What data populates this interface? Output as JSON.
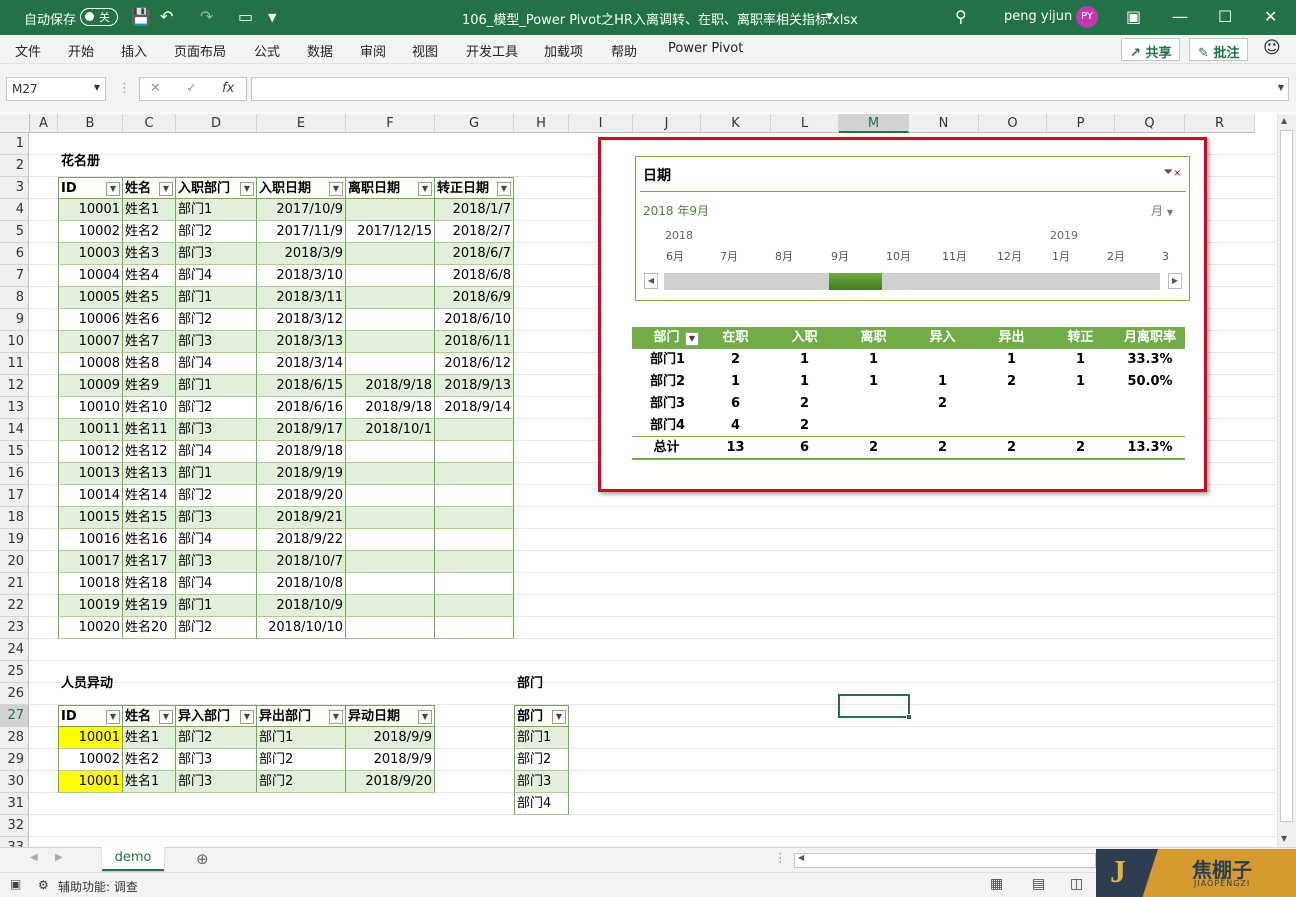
{
  "window": {
    "autosave_label": "自动保存",
    "autosave_state": "关",
    "filename": "106_模型_Power Pivot之HR入离调转、在职、离职率相关指标.xlsx",
    "user": "peng yijun",
    "avatar": "PY"
  },
  "menu": [
    "文件",
    "开始",
    "插入",
    "页面布局",
    "公式",
    "数据",
    "审阅",
    "视图",
    "开发工具",
    "加载项",
    "帮助",
    "Power Pivot"
  ],
  "share_label": "共享",
  "comment_label": "批注",
  "namebox": "M27",
  "fx": "fx",
  "columns": [
    "A",
    "B",
    "C",
    "D",
    "E",
    "F",
    "G",
    "H",
    "I",
    "J",
    "K",
    "L",
    "M",
    "N",
    "O",
    "P",
    "Q",
    "R"
  ],
  "rows": [
    "1",
    "2",
    "3",
    "4",
    "5",
    "6",
    "7",
    "8",
    "9",
    "10",
    "11",
    "12",
    "13",
    "14",
    "15",
    "16",
    "17",
    "18",
    "19",
    "20",
    "21",
    "22",
    "23",
    "24",
    "25",
    "26",
    "27",
    "28",
    "29",
    "30",
    "31",
    "32",
    "33"
  ],
  "roster": {
    "title": "花名册",
    "headers": [
      "ID",
      "姓名",
      "入职部门",
      "入职日期",
      "离职日期",
      "转正日期"
    ],
    "rows": [
      [
        "10001",
        "姓名1",
        "部门1",
        "2017/10/9",
        "",
        "2018/1/7"
      ],
      [
        "10002",
        "姓名2",
        "部门2",
        "2017/11/9",
        "2017/12/15",
        "2018/2/7"
      ],
      [
        "10003",
        "姓名3",
        "部门3",
        "2018/3/9",
        "",
        "2018/6/7"
      ],
      [
        "10004",
        "姓名4",
        "部门4",
        "2018/3/10",
        "",
        "2018/6/8"
      ],
      [
        "10005",
        "姓名5",
        "部门1",
        "2018/3/11",
        "",
        "2018/6/9"
      ],
      [
        "10006",
        "姓名6",
        "部门2",
        "2018/3/12",
        "",
        "2018/6/10"
      ],
      [
        "10007",
        "姓名7",
        "部门3",
        "2018/3/13",
        "",
        "2018/6/11"
      ],
      [
        "10008",
        "姓名8",
        "部门4",
        "2018/3/14",
        "",
        "2018/6/12"
      ],
      [
        "10009",
        "姓名9",
        "部门1",
        "2018/6/15",
        "2018/9/18",
        "2018/9/13"
      ],
      [
        "10010",
        "姓名10",
        "部门2",
        "2018/6/16",
        "2018/9/18",
        "2018/9/14"
      ],
      [
        "10011",
        "姓名11",
        "部门3",
        "2018/9/17",
        "2018/10/1",
        ""
      ],
      [
        "10012",
        "姓名12",
        "部门4",
        "2018/9/18",
        "",
        ""
      ],
      [
        "10013",
        "姓名13",
        "部门1",
        "2018/9/19",
        "",
        ""
      ],
      [
        "10014",
        "姓名14",
        "部门2",
        "2018/9/20",
        "",
        ""
      ],
      [
        "10015",
        "姓名15",
        "部门3",
        "2018/9/21",
        "",
        ""
      ],
      [
        "10016",
        "姓名16",
        "部门4",
        "2018/9/22",
        "",
        ""
      ],
      [
        "10017",
        "姓名17",
        "部门3",
        "2018/10/7",
        "",
        ""
      ],
      [
        "10018",
        "姓名18",
        "部门4",
        "2018/10/8",
        "",
        ""
      ],
      [
        "10019",
        "姓名19",
        "部门1",
        "2018/10/9",
        "",
        ""
      ],
      [
        "10020",
        "姓名20",
        "部门2",
        "2018/10/10",
        "",
        ""
      ]
    ]
  },
  "transfer": {
    "title": "人员异动",
    "headers": [
      "ID",
      "姓名",
      "异入部门",
      "异出部门",
      "异动日期"
    ],
    "rows": [
      [
        "10001",
        "姓名1",
        "部门2",
        "部门1",
        "2018/9/9"
      ],
      [
        "10002",
        "姓名2",
        "部门3",
        "部门2",
        "2018/9/9"
      ],
      [
        "10001",
        "姓名1",
        "部门3",
        "部门2",
        "2018/9/20"
      ]
    ]
  },
  "dept": {
    "title": "部门",
    "header": "部门",
    "rows": [
      "部门1",
      "部门2",
      "部门3",
      "部门4"
    ]
  },
  "slicer": {
    "title": "日期",
    "selection": "2018 年9月",
    "level": "月",
    "years": [
      "2018",
      "2019"
    ],
    "months": [
      "6月",
      "7月",
      "8月",
      "9月",
      "10月",
      "11月",
      "12月",
      "1月",
      "2月",
      "3"
    ],
    "selected_index": 3
  },
  "pivot": {
    "headers": [
      "部门",
      "在职",
      "入职",
      "离职",
      "异入",
      "异出",
      "转正",
      "月离职率"
    ],
    "rows": [
      [
        "部门1",
        "2",
        "1",
        "1",
        "",
        "1",
        "1",
        "33.3%"
      ],
      [
        "部门2",
        "1",
        "1",
        "1",
        "1",
        "2",
        "1",
        "50.0%"
      ],
      [
        "部门3",
        "6",
        "2",
        "",
        "2",
        "",
        "",
        ""
      ],
      [
        "部门4",
        "4",
        "2",
        "",
        "",
        "",
        "",
        ""
      ]
    ],
    "total": [
      "总计",
      "13",
      "6",
      "2",
      "2",
      "2",
      "2",
      "13.3%"
    ]
  },
  "sheet_tab": "demo",
  "status": "辅助功能: 调查",
  "watermark": {
    "letter": "J",
    "cn": "焦棚子",
    "en": "JIAOPENGZI"
  },
  "colors": {
    "excel_green": "#217346",
    "table_accent": "#70ad47",
    "band": "#e2efda",
    "highlight": "#ffff00",
    "annotation_red": "#e0001b"
  }
}
